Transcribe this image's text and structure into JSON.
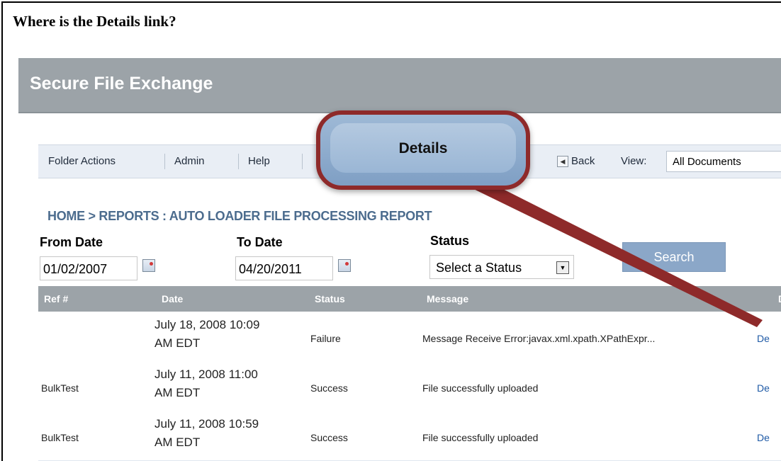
{
  "question": "Where is the Details link?",
  "app": {
    "title": "Secure File Exchange"
  },
  "toolbar": {
    "menu": [
      "Folder Actions",
      "Admin",
      "Help"
    ],
    "back_label": "Back",
    "view_label": "View:",
    "view_value": "All Documents"
  },
  "breadcrumb": {
    "home": "HOME >",
    "path": "REPORTS : AUTO LOADER FILE PROCESSING REPORT"
  },
  "filters": {
    "from_label": "From Date",
    "from_value": "01/02/2007",
    "to_label": "To Date",
    "to_value": "04/20/2011",
    "status_label": "Status",
    "status_value": "Select a Status",
    "search_label": "Search"
  },
  "table": {
    "headers": [
      "Ref #",
      "Date",
      "Status",
      "Message",
      "D"
    ],
    "rows": [
      {
        "ref": "",
        "date_line1": "July 18, 2008 10:09",
        "date_line2": "AM EDT",
        "status": "Failure",
        "message": "Message Receive Error:javax.xml.xpath.XPathExpr...",
        "details": "De"
      },
      {
        "ref": "BulkTest",
        "date_line1": "July 11, 2008 11:00",
        "date_line2": "AM EDT",
        "status": "Success",
        "message": "File successfully uploaded",
        "details": "De"
      },
      {
        "ref": "BulkTest",
        "date_line1": "July 11, 2008 10:59",
        "date_line2": "AM EDT",
        "status": "Success",
        "message": "File successfully uploaded",
        "details": "De"
      }
    ]
  },
  "callout": {
    "label": "Details"
  },
  "colors": {
    "header_bg": "#9ca3a8",
    "link": "#1f5aa6",
    "callout_border": "#8e2a2a"
  }
}
